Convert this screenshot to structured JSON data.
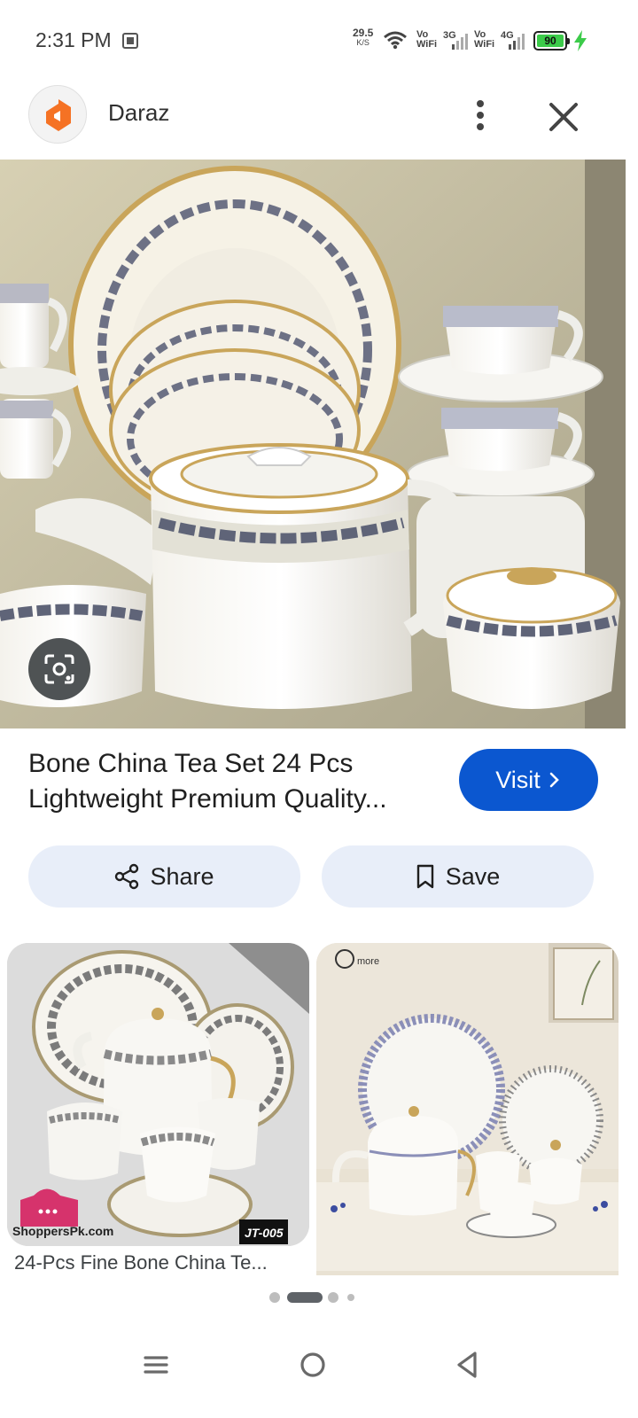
{
  "status_bar": {
    "time": "2:31 PM",
    "net_speed_value": "29.5",
    "net_speed_unit": "K/S",
    "sim1_label_top": "Vo",
    "sim1_label_bottom": "WiFi",
    "sim1_network": "3G",
    "sim2_label_top": "Vo",
    "sim2_label_bottom": "WiFi",
    "sim2_network": "4G",
    "battery_level": "90",
    "charging": true
  },
  "header": {
    "site_name": "Daraz",
    "logo_color": "#f57224"
  },
  "result": {
    "title_line1": "Bone China Tea Set 24 Pcs",
    "title_line2": "Lightweight Premium Quality...",
    "visit_label": "Visit",
    "share_label": "Share",
    "save_label": "Save"
  },
  "related": {
    "item1_caption": "24-Pcs Fine Bone China Te...",
    "item1_watermark": "ShoppersPk.com",
    "item1_badge": "JT-005",
    "item2_watermark": "more"
  },
  "pager": {
    "count": 4,
    "active_index": 1
  },
  "colors": {
    "accent": "#0b57d0",
    "chip_background": "#e8eef9",
    "battery_green": "#3ccb4a"
  },
  "icons": {
    "header": [
      "daraz-logo-icon",
      "more-vert-icon",
      "close-icon"
    ],
    "actions": [
      "share-icon",
      "bookmark-icon",
      "chevron-right-icon",
      "lens-icon"
    ],
    "navbar": [
      "menu-icon",
      "home-icon",
      "back-icon"
    ]
  }
}
